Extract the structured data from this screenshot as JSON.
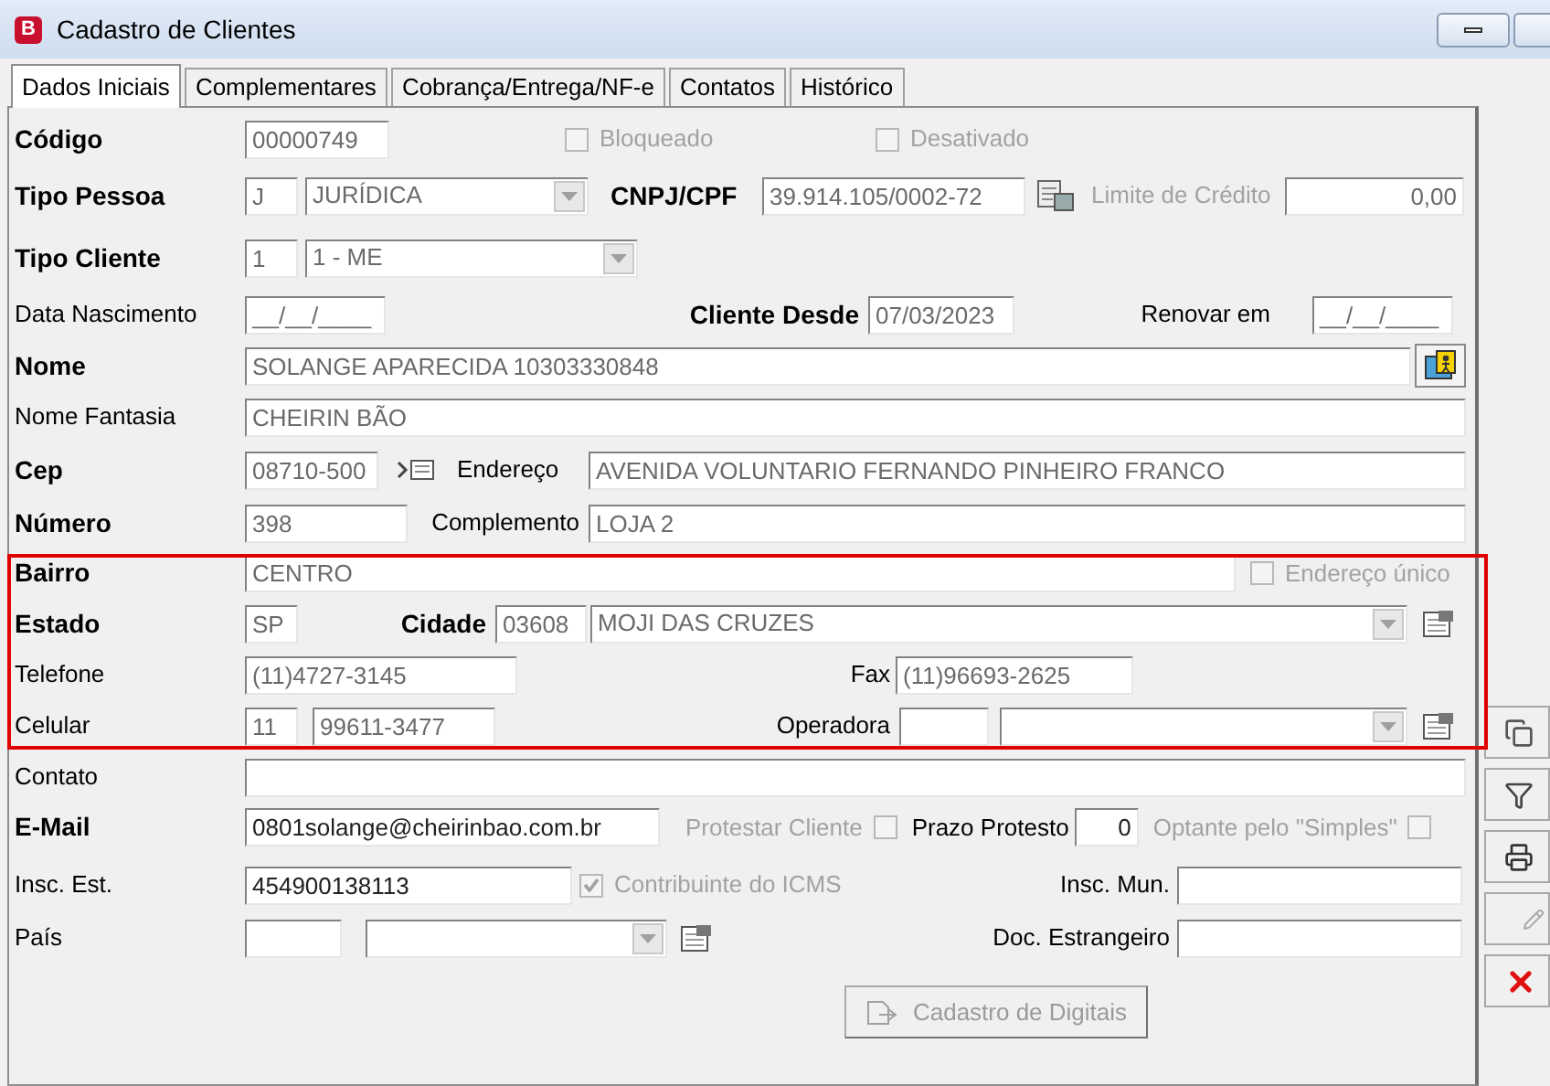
{
  "window": {
    "title": "Cadastro de Clientes",
    "app_icon_letter": "B"
  },
  "tabs": [
    {
      "label": "Dados Iniciais",
      "selected": true
    },
    {
      "label": "Complementares",
      "selected": false
    },
    {
      "label": "Cobrança/Entrega/NF-e",
      "selected": false
    },
    {
      "label": "Contatos",
      "selected": false
    },
    {
      "label": "Histórico",
      "selected": false
    }
  ],
  "codigo": {
    "label": "Código",
    "required": true,
    "value": "00000749"
  },
  "bloqueado": {
    "label": "Bloqueado",
    "checked": false,
    "disabled": true
  },
  "desativado": {
    "label": "Desativado",
    "checked": false,
    "disabled": true
  },
  "tipo_pessoa": {
    "label": "Tipo Pessoa",
    "required": true,
    "code": "J",
    "value": "JURÍDICA"
  },
  "cnpj_cpf": {
    "label": "CNPJ/CPF",
    "required": true,
    "value": "39.914.105/0002-72"
  },
  "limite_credito": {
    "label": "Limite de Crédito",
    "disabled": true,
    "value": "0,00"
  },
  "tipo_cliente": {
    "label": "Tipo Cliente",
    "required": true,
    "code": "1",
    "value": "1 - ME"
  },
  "data_nascimento": {
    "label": "Data Nascimento",
    "required": false,
    "value": "__/__/____"
  },
  "cliente_desde": {
    "label": "Cliente Desde",
    "required": true,
    "value": "07/03/2023"
  },
  "renovar_em": {
    "label": "Renovar em",
    "required": false,
    "value": "__/__/____"
  },
  "nome": {
    "label": "Nome",
    "required": true,
    "value": "SOLANGE APARECIDA 10303330848"
  },
  "nome_fantasia": {
    "label": "Nome Fantasia",
    "required": false,
    "value": "CHEIRIN BÃO"
  },
  "cep": {
    "label": "Cep",
    "required": true,
    "value": "08710-500"
  },
  "endereco": {
    "label": "Endereço",
    "required": false,
    "value": "AVENIDA VOLUNTARIO FERNANDO PINHEIRO FRANCO"
  },
  "numero": {
    "label": "Número",
    "required": true,
    "value": "398"
  },
  "complemento": {
    "label": "Complemento",
    "required": false,
    "value": "LOJA 2"
  },
  "bairro": {
    "label": "Bairro",
    "required": true,
    "value": "CENTRO"
  },
  "endereco_unico": {
    "label": "Endereço único",
    "checked": false,
    "disabled": true
  },
  "estado": {
    "label": "Estado",
    "required": true,
    "value": "SP"
  },
  "cidade": {
    "label": "Cidade",
    "required": true,
    "code": "03608",
    "value": "MOJI DAS CRUZES"
  },
  "telefone": {
    "label": "Telefone",
    "required": false,
    "value": "(11)4727-3145"
  },
  "fax": {
    "label": "Fax",
    "required": false,
    "value": "(11)96693-2625"
  },
  "celular": {
    "label": "Celular",
    "required": false,
    "ddd": "11",
    "value": "99611-3477"
  },
  "operadora": {
    "label": "Operadora",
    "required": false
  },
  "contato": {
    "label": "Contato",
    "required": false
  },
  "email": {
    "label": "E-Mail",
    "required": true,
    "value": "0801solange@cheirinbao.com.br"
  },
  "protestar_cliente": {
    "label": "Protestar Cliente",
    "checked": false,
    "disabled": true
  },
  "prazo_protesto": {
    "label": "Prazo Protesto",
    "required": false,
    "value": "0"
  },
  "optante_simples": {
    "label": "Optante pelo \"Simples\"",
    "checked": false,
    "disabled": true
  },
  "insc_est": {
    "label": "Insc. Est.",
    "required": false,
    "value": "454900138113"
  },
  "contribuinte_icms": {
    "label": "Contribuinte do ICMS",
    "checked": true,
    "disabled": true
  },
  "insc_mun": {
    "label": "Insc. Mun.",
    "required": false
  },
  "pais": {
    "label": "País",
    "required": false
  },
  "doc_estrangeiro": {
    "label": "Doc. Estrangeiro",
    "required": false
  },
  "cadastro_digitais": {
    "label": "Cadastro de Digitais",
    "disabled": true
  }
}
